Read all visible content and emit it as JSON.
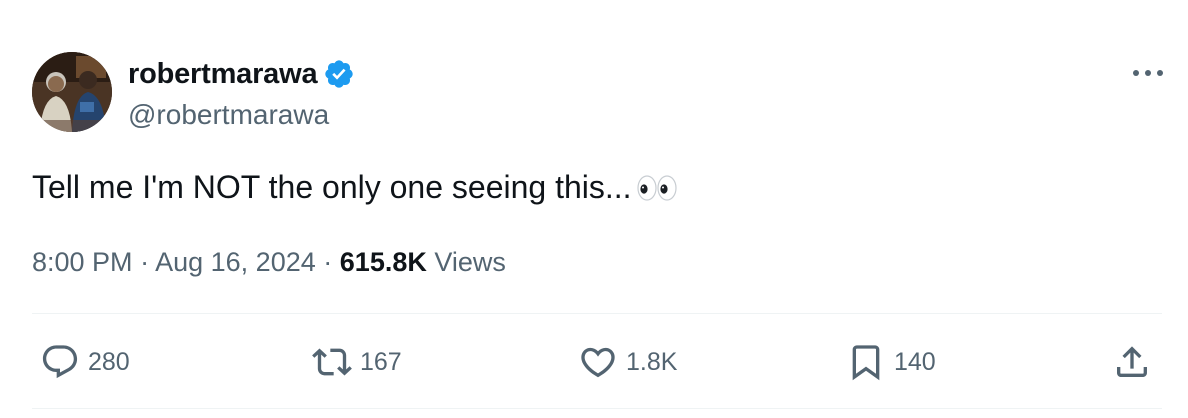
{
  "author": {
    "display_name": "robertmarawa",
    "handle": "@robertmarawa",
    "verified": true,
    "verified_color": "#1d9bf0"
  },
  "tweet": {
    "text": "Tell me I'm NOT the only one seeing this...",
    "emoji": "eyes-emoji"
  },
  "meta": {
    "time": "8:00 PM",
    "separator": "·",
    "date": "Aug 16, 2024",
    "views_count": "615.8K",
    "views_label": "Views"
  },
  "actions": {
    "reply_count": "280",
    "retweet_count": "167",
    "like_count": "1.8K",
    "bookmark_count": "140"
  },
  "colors": {
    "text_primary": "#0f1419",
    "text_secondary": "#536471",
    "divider": "#eff3f4"
  }
}
